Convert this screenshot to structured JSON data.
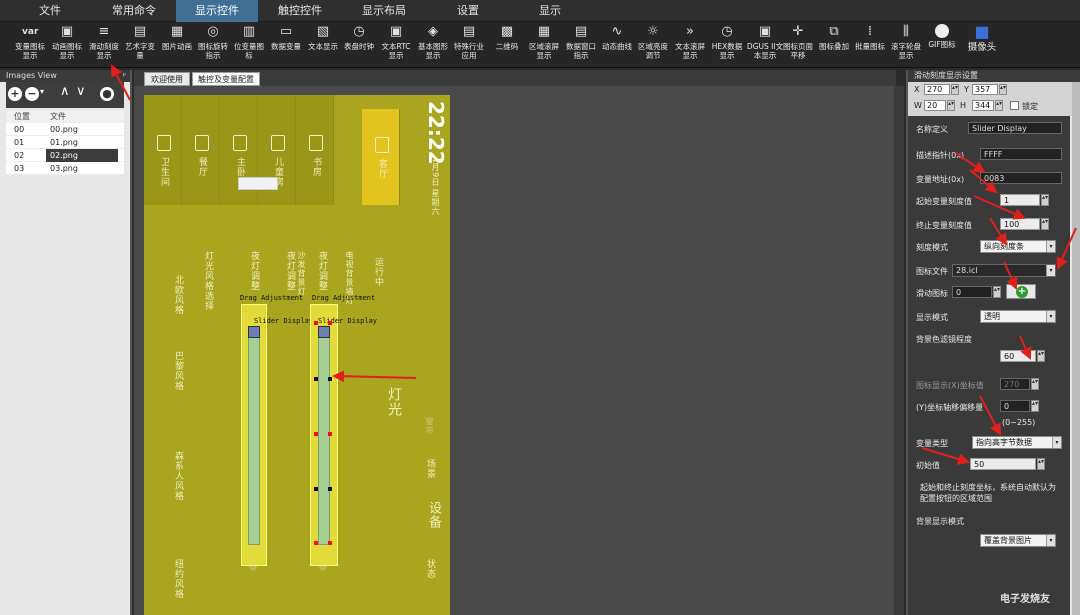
{
  "menu": [
    "文件",
    "常用命令",
    "显示控件",
    "触控控件",
    "显示布局",
    "设置",
    "显示"
  ],
  "active_menu_index": 2,
  "ribbon": [
    {
      "icon": "var-icon",
      "label": "变量图标\n显示"
    },
    {
      "icon": "animated-icon-icon",
      "label": "动画图标\n显示"
    },
    {
      "icon": "slider-icon",
      "label": "滑动刻度\n显示"
    },
    {
      "icon": "art-text-icon",
      "label": "艺术字变\n量"
    },
    {
      "icon": "image-animation-icon",
      "label": "图片动画"
    },
    {
      "icon": "rotate-icon",
      "label": "图标旋转\n指示"
    },
    {
      "icon": "bit-variable-icon",
      "label": "位变量图\n标"
    },
    {
      "icon": "data-variable-icon",
      "label": "数据变量"
    },
    {
      "icon": "text-display-icon",
      "label": "文本显示"
    },
    {
      "icon": "clock-icon",
      "label": "表盘时钟"
    },
    {
      "icon": "rtc-text-icon",
      "label": "文本RTC\n显示"
    },
    {
      "icon": "graphic-icon",
      "label": "基本图形\n显示"
    },
    {
      "icon": "industry-icon",
      "label": "特殊行业\n应用"
    },
    {
      "icon": "qrcode-icon",
      "label": "二维码"
    },
    {
      "icon": "region-scroll-icon",
      "label": "区域滚屏\n显示"
    },
    {
      "icon": "data-window-icon",
      "label": "数据窗口\n指示"
    },
    {
      "icon": "curve-icon",
      "label": "动态曲线"
    },
    {
      "icon": "brightness-icon",
      "label": "区域亮度\n调节"
    },
    {
      "icon": "text-scroll-icon",
      "label": "文本滚屏\n显示"
    },
    {
      "icon": "hex-icon",
      "label": "HEX数据\n显示"
    },
    {
      "icon": "dgus-text-icon",
      "label": "DGUS II文\n本显示"
    },
    {
      "icon": "move-icon",
      "label": "图标页面\n平移"
    },
    {
      "icon": "overlay-icon",
      "label": "图标叠加"
    },
    {
      "icon": "batch-icon",
      "label": "批量图标"
    },
    {
      "icon": "scroll-wheel-icon",
      "label": "滚字轮盘\n显示"
    },
    {
      "icon": "gif-icon",
      "label": "GIF图标"
    },
    {
      "icon": "camera-icon",
      "label": "摄像头"
    }
  ],
  "left_panel": {
    "title": "Images View",
    "pin": "ᵖ",
    "columns": [
      "位置",
      "文件"
    ],
    "rows": [
      {
        "pos": "00",
        "file": "00.png"
      },
      {
        "pos": "01",
        "file": "01.png"
      },
      {
        "pos": "02",
        "file": "02.png"
      },
      {
        "pos": "03",
        "file": "03.png"
      }
    ],
    "selected_row": 2
  },
  "tabs": [
    "欢迎使用",
    "触控及变量配置"
  ],
  "active_tab": 1,
  "design": {
    "clock": "22:22",
    "date": "4月9日",
    "weekday": "星期六",
    "rooms": [
      "卫生间",
      "餐厅",
      "主卧",
      "儿童房",
      "书房",
      "客厅"
    ],
    "room_subtitles": [
      "北欧风格",
      "灯光风格选择",
      "夜灯调整",
      "夜灯调整",
      "夜灯调整",
      "运行中"
    ],
    "room_subtitles2": [
      "",
      "",
      "",
      "沙发背景灯",
      "电视背景墙灯",
      ""
    ],
    "style_labels": [
      "巴黎风格",
      "森系人风格",
      "纽约风格"
    ],
    "lamp_label": "灯光",
    "device_label": "设备",
    "scene_label": "场景",
    "status_label": "状态",
    "curtain_label": "窗帘",
    "drag_labels": [
      "Drag Adjustment",
      "Drag Adjustment"
    ],
    "slider_labels": [
      "Slider Display",
      "Slider Display"
    ]
  },
  "properties": {
    "title": "滑动刻度显示设置",
    "x_label": "X",
    "x": "270",
    "y_label": "Y",
    "y": "357",
    "w_label": "W",
    "w": "20",
    "h_label": "H",
    "h": "344",
    "lock_label": "锁定",
    "name_label": "名称定义",
    "name": "Slider Display",
    "desc_label": "描述指针(0x)",
    "desc": "FFFF",
    "var_addr_label": "变量地址(0x)",
    "var_addr": "0083",
    "start_label": "起始变量刻度值",
    "start": "1",
    "end_label": "终止变量刻度值",
    "end": "100",
    "mode_label": "刻度模式",
    "mode": "纵向刻度条",
    "icon_file_label": "图标文件",
    "icon_file": "28.icl",
    "slide_icon_label": "滑动图标",
    "slide_icon": "0",
    "display_mode_label": "显示模式",
    "display_mode": "透明",
    "bg_label": "背景色滤镜程度",
    "bg": "60",
    "x_offset_label": "图标显示(X)坐标值",
    "x_offset": "270",
    "y_offset_label": "(Y)坐标轴移偏移量",
    "y_offset": "0",
    "range_note": "(0~255)",
    "var_type_label": "变量类型",
    "var_type": "指向高字节数据",
    "init_label": "初始值",
    "init": "50",
    "note": "起始和终止刻度坐标，系统自动默认为\n配置按钮的区域范围",
    "bg_display_label": "背景显示模式",
    "bg_display": "覆盖背景图片"
  },
  "watermark": "电子发烧友",
  "colors": {
    "accent": "#3f6f95",
    "design_bg": "#a9a51e",
    "selected_room": "#e3c31d",
    "arrow": "#e0201c"
  }
}
